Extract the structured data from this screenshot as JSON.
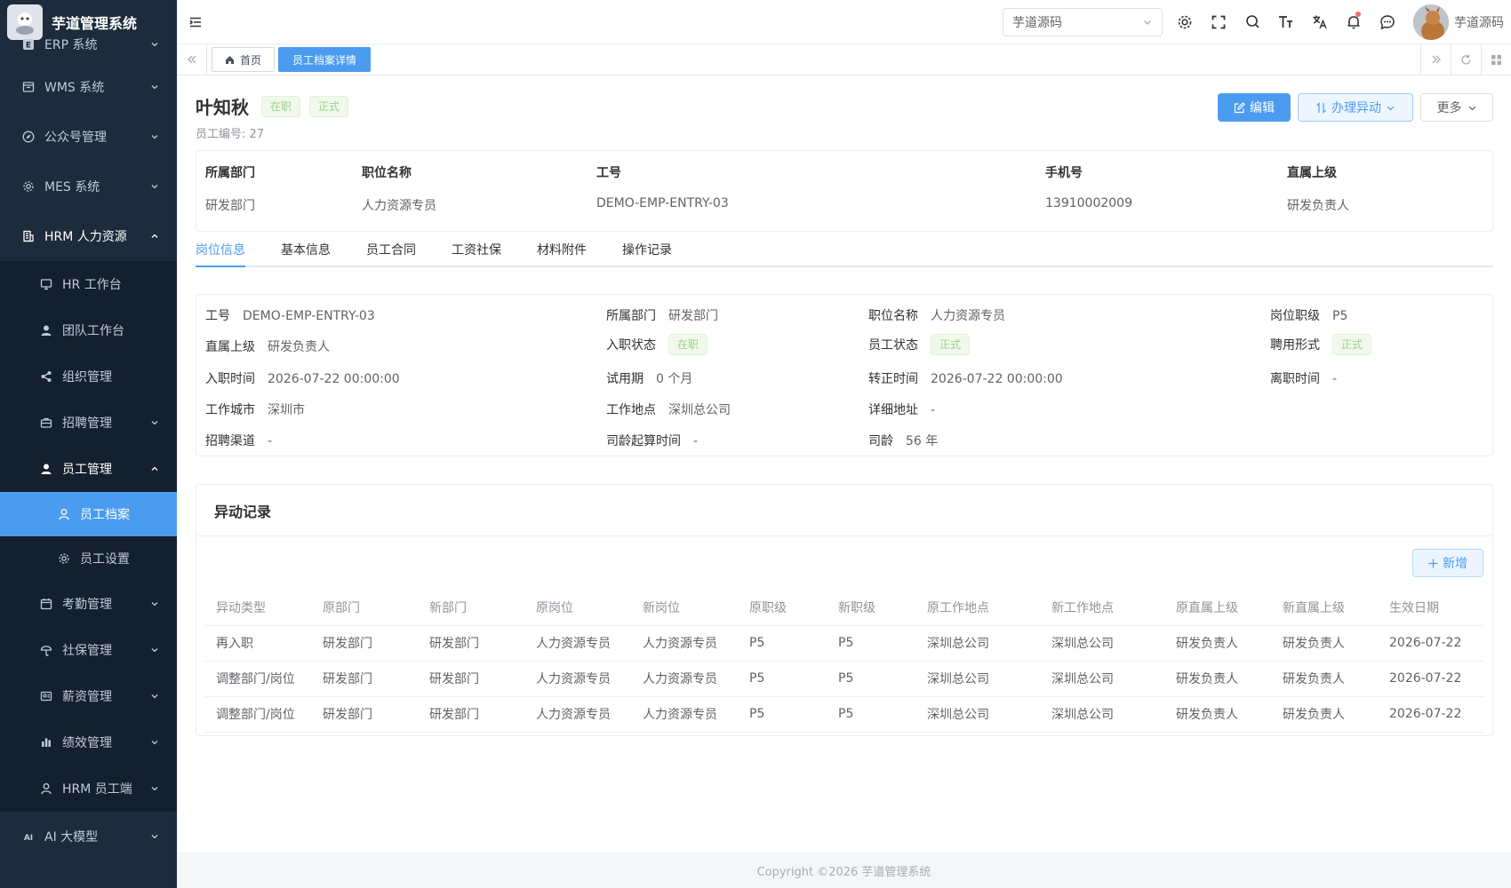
{
  "app": {
    "title": "芋道管理系统"
  },
  "sidebar": {
    "items": [
      {
        "label": "ERP 系统",
        "icon": "erp-icon"
      },
      {
        "label": "WMS 系统",
        "icon": "warehouse-icon"
      },
      {
        "label": "公众号管理",
        "icon": "compass-icon"
      },
      {
        "label": "MES 系统",
        "icon": "gear-icon"
      },
      {
        "label": "HRM 人力资源",
        "icon": "building-icon"
      }
    ],
    "hrm_children": [
      {
        "label": "HR 工作台",
        "icon": "monitor-icon"
      },
      {
        "label": "团队工作台",
        "icon": "user-icon"
      },
      {
        "label": "组织管理",
        "icon": "share-icon"
      },
      {
        "label": "招聘管理",
        "icon": "briefcase-icon"
      },
      {
        "label": "员工管理",
        "icon": "user-icon"
      }
    ],
    "employee_children": [
      {
        "label": "员工档案",
        "icon": "user-outline-icon"
      },
      {
        "label": "员工设置",
        "icon": "gear-icon"
      }
    ],
    "hrm_rest": [
      {
        "label": "考勤管理",
        "icon": "calendar-icon"
      },
      {
        "label": "社保管理",
        "icon": "umbrella-icon"
      },
      {
        "label": "薪资管理",
        "icon": "payroll-icon"
      },
      {
        "label": "绩效管理",
        "icon": "bar-chart-icon"
      },
      {
        "label": "HRM 员工端",
        "icon": "user-outline-icon"
      }
    ],
    "ai": {
      "label": "AI 大模型",
      "icon": "ai-icon"
    }
  },
  "header": {
    "tenant_select": "芋道源码",
    "user_name": "芋道源码"
  },
  "tags": {
    "home": "首页",
    "current": "员工档案详情"
  },
  "profile": {
    "name": "叶知秋",
    "status_tag": "在职",
    "type_tag": "正式",
    "employee_no_label": "员工编号:",
    "employee_no": "27",
    "actions": {
      "edit": "编辑",
      "transfer": "办理异动",
      "more": "更多"
    }
  },
  "summary": {
    "columns": [
      {
        "label": "所属部门",
        "value": "研发部门"
      },
      {
        "label": "职位名称",
        "value": "人力资源专员"
      },
      {
        "label": "工号",
        "value": "DEMO-EMP-ENTRY-03"
      },
      {
        "label": "手机号",
        "value": "13910002009"
      },
      {
        "label": "直属上级",
        "value": "研发负责人"
      }
    ]
  },
  "tabs": [
    "岗位信息",
    "基本信息",
    "员工合同",
    "工资社保",
    "材料附件",
    "操作记录"
  ],
  "position_info": {
    "rows": [
      [
        {
          "label": "工号",
          "value": "DEMO-EMP-ENTRY-03"
        },
        {
          "label": "所属部门",
          "value": "研发部门"
        },
        {
          "label": "职位名称",
          "value": "人力资源专员"
        },
        {
          "label": "岗位职级",
          "value": "P5"
        }
      ],
      [
        {
          "label": "直属上级",
          "value": "研发负责人"
        },
        {
          "label": "入职状态",
          "tag": "在职"
        },
        {
          "label": "员工状态",
          "tag": "正式"
        },
        {
          "label": "聘用形式",
          "tag": "正式"
        }
      ],
      [
        {
          "label": "入职时间",
          "value": "2026-07-22 00:00:00"
        },
        {
          "label": "试用期",
          "value": "0 个月"
        },
        {
          "label": "转正时间",
          "value": "2026-07-22 00:00:00"
        },
        {
          "label": "离职时间",
          "value": "-"
        }
      ],
      [
        {
          "label": "工作城市",
          "value": "深圳市"
        },
        {
          "label": "工作地点",
          "value": "深圳总公司"
        },
        {
          "label": "详细地址",
          "value": "-"
        }
      ],
      [
        {
          "label": "招聘渠道",
          "value": "-"
        },
        {
          "label": "司龄起算时间",
          "value": "-"
        },
        {
          "label": "司龄",
          "value": "56 年"
        }
      ]
    ]
  },
  "changes": {
    "title": "异动记录",
    "add_label": "新增",
    "headers": [
      "异动类型",
      "原部门",
      "新部门",
      "原岗位",
      "新岗位",
      "原职级",
      "新职级",
      "原工作地点",
      "新工作地点",
      "原直属上级",
      "新直属上级",
      "生效日期"
    ],
    "rows": [
      [
        "再入职",
        "研发部门",
        "研发部门",
        "人力资源专员",
        "人力资源专员",
        "P5",
        "P5",
        "深圳总公司",
        "深圳总公司",
        "研发负责人",
        "研发负责人",
        "2026-07-22"
      ],
      [
        "调整部门/岗位",
        "研发部门",
        "研发部门",
        "人力资源专员",
        "人力资源专员",
        "P5",
        "P5",
        "深圳总公司",
        "深圳总公司",
        "研发负责人",
        "研发负责人",
        "2026-07-22"
      ],
      [
        "调整部门/岗位",
        "研发部门",
        "研发部门",
        "人力资源专员",
        "人力资源专员",
        "P5",
        "P5",
        "深圳总公司",
        "深圳总公司",
        "研发负责人",
        "研发负责人",
        "2026-07-22"
      ]
    ]
  },
  "footer": {
    "copyright": "Copyright ©2026 芋道管理系统"
  },
  "colors": {
    "primary": "#4b9cf0",
    "sidebar_bg": "#1d2b3c",
    "tag_green": "#f0f9eb"
  }
}
